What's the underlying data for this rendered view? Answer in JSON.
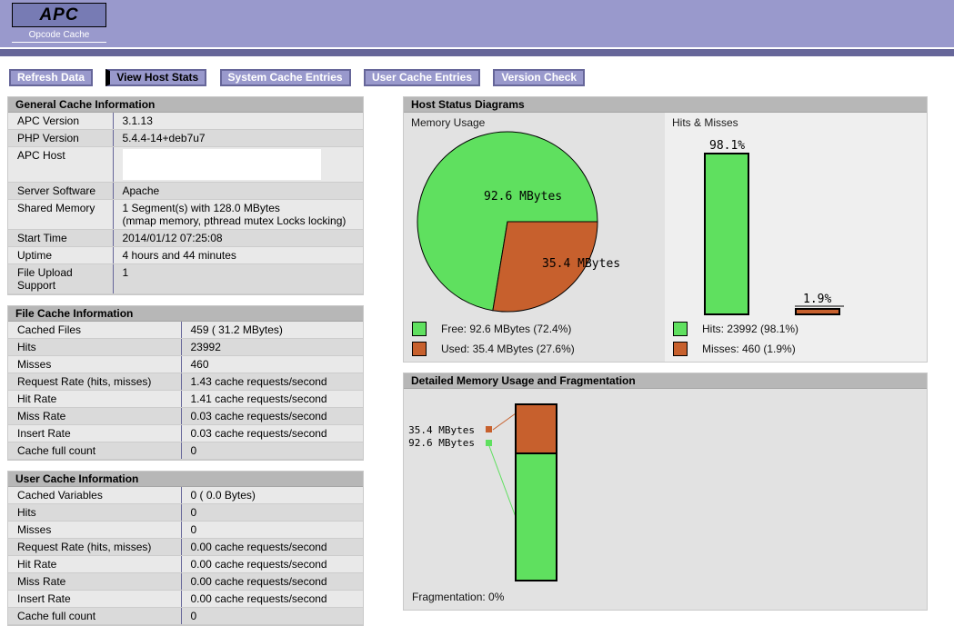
{
  "header": {
    "logo": "APC",
    "subtitle": "Opcode Cache"
  },
  "nav": {
    "items": [
      {
        "label": "Refresh Data",
        "active": false
      },
      {
        "label": "View Host Stats",
        "active": true
      },
      {
        "label": "System Cache Entries",
        "active": false
      },
      {
        "label": "User Cache Entries",
        "active": false
      },
      {
        "label": "Version Check",
        "active": false
      }
    ]
  },
  "tables": {
    "general": {
      "title": "General Cache Information",
      "rows": [
        {
          "label": "APC Version",
          "value": "3.1.13"
        },
        {
          "label": "PHP Version",
          "value": "5.4.4-14+deb7u7"
        },
        {
          "label": "APC Host",
          "value": "",
          "redacted": true
        },
        {
          "label": "Server Software",
          "value": "Apache"
        },
        {
          "label": "Shared Memory",
          "value": "1 Segment(s) with 128.0 MBytes\n(mmap memory, pthread mutex Locks locking)"
        },
        {
          "label": "Start Time",
          "value": "2014/01/12 07:25:08"
        },
        {
          "label": "Uptime",
          "value": "4 hours and 44 minutes"
        },
        {
          "label": "File Upload Support",
          "value": "1"
        }
      ]
    },
    "file_cache": {
      "title": "File Cache Information",
      "rows": [
        {
          "label": "Cached Files",
          "value": "459 ( 31.2 MBytes)"
        },
        {
          "label": "Hits",
          "value": "23992"
        },
        {
          "label": "Misses",
          "value": "460"
        },
        {
          "label": "Request Rate (hits, misses)",
          "value": "1.43 cache requests/second"
        },
        {
          "label": "Hit Rate",
          "value": "1.41 cache requests/second"
        },
        {
          "label": "Miss Rate",
          "value": "0.03 cache requests/second"
        },
        {
          "label": "Insert Rate",
          "value": "0.03 cache requests/second"
        },
        {
          "label": "Cache full count",
          "value": "0"
        }
      ]
    },
    "user_cache": {
      "title": "User Cache Information",
      "rows": [
        {
          "label": "Cached Variables",
          "value": "0 ( 0.0 Bytes)"
        },
        {
          "label": "Hits",
          "value": "0"
        },
        {
          "label": "Misses",
          "value": "0"
        },
        {
          "label": "Request Rate (hits, misses)",
          "value": "0.00 cache requests/second"
        },
        {
          "label": "Hit Rate",
          "value": "0.00 cache requests/second"
        },
        {
          "label": "Miss Rate",
          "value": "0.00 cache requests/second"
        },
        {
          "label": "Insert Rate",
          "value": "0.00 cache requests/second"
        },
        {
          "label": "Cache full count",
          "value": "0"
        }
      ]
    }
  },
  "host_status": {
    "title": "Host Status Diagrams",
    "memory_usage": {
      "label": "Memory Usage",
      "pie_label_free": "92.6 MBytes",
      "pie_label_used": "35.4 MBytes",
      "legend": [
        {
          "label": "Free: 92.6 MBytes (72.4%)"
        },
        {
          "label": "Used: 35.4 MBytes (27.6%)"
        }
      ]
    },
    "hits_misses": {
      "label": "Hits & Misses",
      "bar_labels": [
        "98.1%",
        "1.9%"
      ],
      "legend": [
        {
          "label": "Hits: 23992 (98.1%)"
        },
        {
          "label": "Misses: 460 (1.9%)"
        }
      ]
    }
  },
  "detailed": {
    "title": "Detailed Memory Usage and Fragmentation",
    "segment_labels": [
      "35.4 MBytes",
      "92.6 MBytes"
    ],
    "footer": "Fragmentation: 0%"
  },
  "colors": {
    "free": "#5fe05f",
    "used": "#c7602d",
    "header": "#9999cc",
    "rule": "#666699",
    "logo_box": "#777bb4"
  },
  "chart_data": [
    {
      "type": "pie",
      "title": "Memory Usage",
      "slices": [
        {
          "label": "Free",
          "mbytes": 92.6,
          "percent": 72.4,
          "color": "#5fe05f"
        },
        {
          "label": "Used",
          "mbytes": 35.4,
          "percent": 27.6,
          "color": "#c7602d"
        }
      ],
      "legend_position": "bottom"
    },
    {
      "type": "bar",
      "title": "Hits & Misses",
      "categories": [
        "Hits",
        "Misses"
      ],
      "values": [
        23992,
        460
      ],
      "percents": [
        98.1,
        1.9
      ],
      "colors": [
        "#5fe05f",
        "#c7602d"
      ],
      "legend_position": "bottom"
    },
    {
      "type": "bar",
      "stacked": true,
      "title": "Detailed Memory Usage and Fragmentation",
      "segments": [
        {
          "label": "Used",
          "mbytes": 35.4,
          "color": "#c7602d"
        },
        {
          "label": "Free",
          "mbytes": 92.6,
          "color": "#5fe05f"
        }
      ],
      "total_mbytes": 128.0,
      "fragmentation_percent": 0
    }
  ]
}
